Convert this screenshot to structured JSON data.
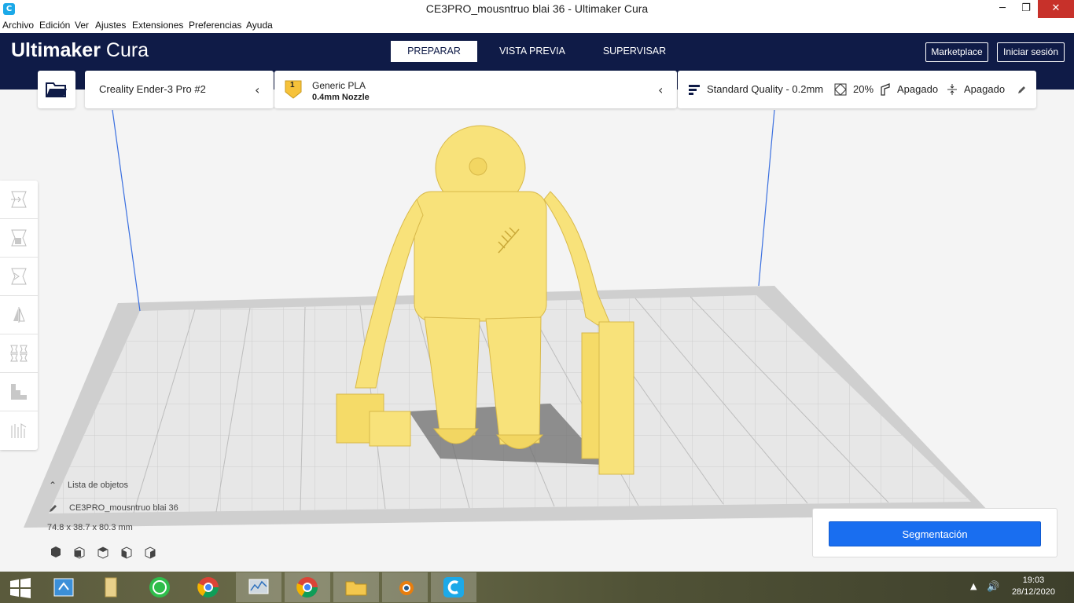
{
  "window": {
    "title": "CE3PRO_mousntruo blai 36 - Ultimaker Cura",
    "minimize": "─",
    "restore": "❐",
    "close": "✕"
  },
  "menu": [
    "Archivo",
    "Edición",
    "Ver",
    "Ajustes",
    "Extensiones",
    "Preferencias",
    "Ayuda"
  ],
  "header": {
    "logo_bold": "Ultimaker",
    "logo_light": " Cura",
    "tabs": [
      "PREPARAR",
      "VISTA PREVIA",
      "SUPERVISAR"
    ],
    "active_tab": "PREPARAR",
    "marketplace": "Marketplace",
    "signin": "Iniciar sesión"
  },
  "printer": {
    "name": "Creality Ender-3 Pro #2"
  },
  "material": {
    "extruder": "1",
    "name": "Generic PLA",
    "nozzle": "0.4mm Nozzle"
  },
  "settings": {
    "profile": "Standard Quality - 0.2mm",
    "infill": "20%",
    "support": "Apagado",
    "adhesion": "Apagado"
  },
  "objects": {
    "header": "Lista de objetos",
    "name": "CE3PRO_mousntruo blai 36",
    "dimensions": "74.8 x 38.7 x 80.3 mm"
  },
  "slice": {
    "button": "Segmentación"
  },
  "taskbar": {
    "time": "19:03",
    "date": "28/12/2020"
  },
  "colors": {
    "header_bg": "#0f1b47",
    "accent": "#196ef0",
    "model": "#f8e27a"
  }
}
